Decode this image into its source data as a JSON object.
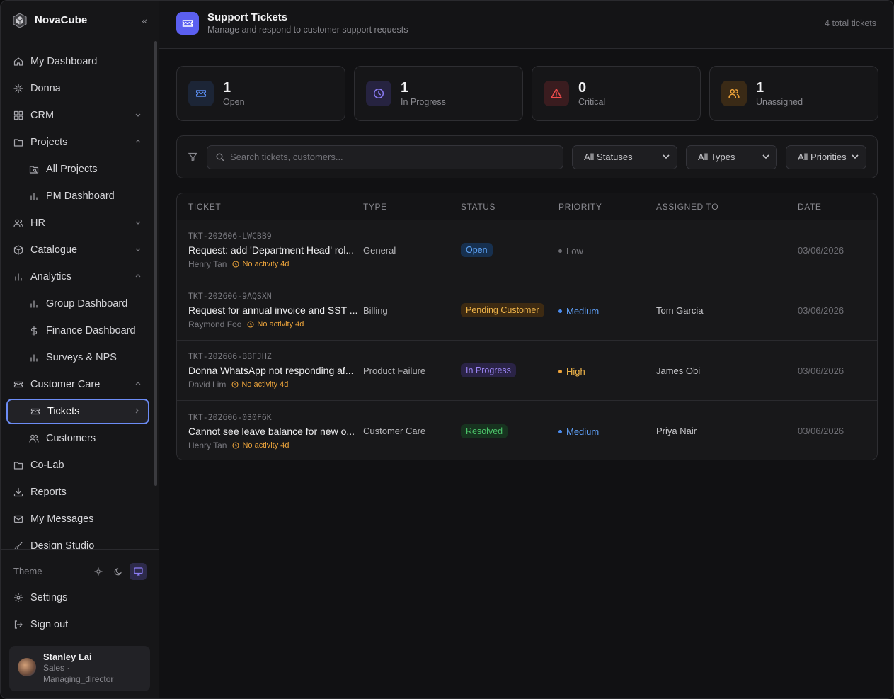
{
  "brand": {
    "name": "NovaCube"
  },
  "nav": [
    {
      "label": "My Dashboard",
      "icon": "home-icon",
      "chevron": ""
    },
    {
      "label": "Donna",
      "icon": "sparkle-icon",
      "chevron": ""
    },
    {
      "label": "CRM",
      "icon": "grid-icon",
      "chevron": "⌄"
    },
    {
      "label": "Projects",
      "icon": "folder-icon",
      "chevron": "⌃"
    },
    {
      "label": "All Projects",
      "icon": "folder-search-icon",
      "chevron": "",
      "sub": true
    },
    {
      "label": "PM Dashboard",
      "icon": "bar-chart-icon",
      "chevron": "",
      "sub": true
    },
    {
      "label": "HR",
      "icon": "users-icon",
      "chevron": "⌄"
    },
    {
      "label": "Catalogue",
      "icon": "package-icon",
      "chevron": "⌄"
    },
    {
      "label": "Analytics",
      "icon": "bar-chart-icon",
      "chevron": "⌃"
    },
    {
      "label": "Group Dashboard",
      "icon": "bar-chart-icon",
      "chevron": "",
      "sub": true
    },
    {
      "label": "Finance Dashboard",
      "icon": "dollar-icon",
      "chevron": "",
      "sub": true
    },
    {
      "label": "Surveys & NPS",
      "icon": "bar-chart-icon",
      "chevron": "",
      "sub": true
    },
    {
      "label": "Customer Care",
      "icon": "ticket-icon",
      "chevron": "⌃"
    },
    {
      "label": "Tickets",
      "icon": "ticket-icon",
      "chevron": "›",
      "sub": true,
      "active": true
    },
    {
      "label": "Customers",
      "icon": "users-icon",
      "chevron": "",
      "sub": true
    },
    {
      "label": "Co-Lab",
      "icon": "folder-icon",
      "chevron": ""
    },
    {
      "label": "Reports",
      "icon": "download-icon",
      "chevron": ""
    },
    {
      "label": "My Messages",
      "icon": "mail-icon",
      "chevron": ""
    },
    {
      "label": "Design Studio",
      "icon": "brush-icon",
      "chevron": ""
    }
  ],
  "theme": {
    "label": "Theme"
  },
  "settings_label": "Settings",
  "signout_label": "Sign out",
  "user": {
    "name": "Stanley Lai",
    "role_line1": "Sales ·",
    "role_line2": "Managing_director"
  },
  "header": {
    "title": "Support Tickets",
    "subtitle": "Manage and respond to customer support requests",
    "total": "4 total tickets"
  },
  "stats": [
    {
      "value": "1",
      "label": "Open",
      "icon": "ticket-icon",
      "bg": "#1c2536",
      "color": "#5b8def"
    },
    {
      "value": "1",
      "label": "In Progress",
      "icon": "clock-icon",
      "bg": "#262340",
      "color": "#8b7cf6"
    },
    {
      "value": "0",
      "label": "Critical",
      "icon": "alert-triangle-icon",
      "bg": "#3a1c1f",
      "color": "#ef4b4b"
    },
    {
      "value": "1",
      "label": "Unassigned",
      "icon": "users-icon",
      "bg": "#3a2a16",
      "color": "#f0a43a"
    }
  ],
  "filters": {
    "search_placeholder": "Search tickets, customers...",
    "status": "All Statuses",
    "type": "All Types",
    "priority": "All Priorities"
  },
  "table": {
    "columns": [
      "TICKET",
      "TYPE",
      "STATUS",
      "PRIORITY",
      "ASSIGNED TO",
      "DATE"
    ],
    "rows": [
      {
        "id": "TKT-202606-LWCBB9",
        "title": "Request: add 'Department Head' rol...",
        "customer": "Henry Tan",
        "activity": "No activity 4d",
        "type": "General",
        "status": "Open",
        "status_bg": "#17304f",
        "status_fg": "#5ea3f5",
        "priority": "Low",
        "prio_color": "#6e6e74",
        "prio_text": "#7a7a80",
        "assigned": "—",
        "date": "03/06/2026"
      },
      {
        "id": "TKT-202606-9AQSXN",
        "title": "Request for annual invoice and SST ...",
        "customer": "Raymond Foo",
        "activity": "No activity 4d",
        "type": "Billing",
        "status": "Pending Customer",
        "status_bg": "#3d2a12",
        "status_fg": "#f0b54a",
        "priority": "Medium",
        "prio_color": "#4a8cf0",
        "prio_text": "#5e9ef5",
        "assigned": "Tom Garcia",
        "date": "03/06/2026"
      },
      {
        "id": "TKT-202606-BBFJHZ",
        "title": "Donna WhatsApp not responding af...",
        "customer": "David Lim",
        "activity": "No activity 4d",
        "type": "Product Failure",
        "status": "In Progress",
        "status_bg": "#2a2346",
        "status_fg": "#9c86f5",
        "priority": "High",
        "prio_color": "#f0a43a",
        "prio_text": "#f0b54a",
        "assigned": "James Obi",
        "date": "03/06/2026"
      },
      {
        "id": "TKT-202606-030F6K",
        "title": "Cannot see leave balance for new o...",
        "customer": "Henry Tan",
        "activity": "No activity 4d",
        "type": "Customer Care",
        "status": "Resolved",
        "status_bg": "#17331f",
        "status_fg": "#4cc46a",
        "priority": "Medium",
        "prio_color": "#4a8cf0",
        "prio_text": "#5e9ef5",
        "assigned": "Priya Nair",
        "date": "03/06/2026"
      }
    ]
  }
}
